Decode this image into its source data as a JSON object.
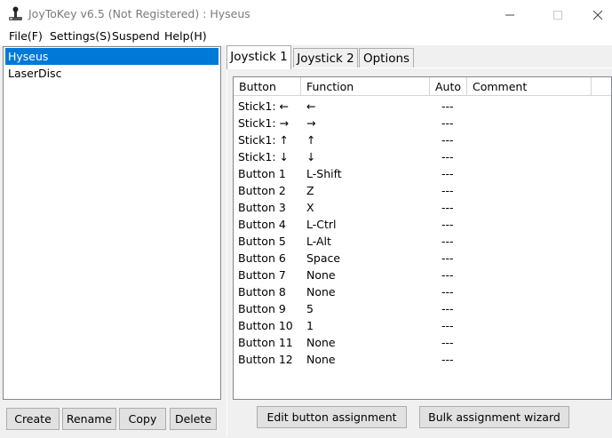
{
  "window": {
    "title": "JoyToKey v6.5 (Not Registered) : Hyseus",
    "icon": "joystick-app-icon"
  },
  "menu": {
    "items": [
      "File(F)",
      "Settings(S)",
      "Suspend",
      "Help(H)"
    ]
  },
  "profiles": {
    "items": [
      "Hyseus",
      "LaserDisc"
    ],
    "selected": "Hyseus"
  },
  "profile_buttons": {
    "create": "Create",
    "rename": "Rename",
    "copy": "Copy",
    "delete": "Delete"
  },
  "tabs": {
    "items": [
      "Joystick 1",
      "Joystick 2",
      "Options"
    ],
    "active": "Joystick 1"
  },
  "grid": {
    "headers": [
      "Button",
      "Function",
      "Auto",
      "Comment"
    ],
    "rows": [
      {
        "button": "Stick1: ←",
        "function": "←",
        "auto": "---",
        "comment": ""
      },
      {
        "button": "Stick1: →",
        "function": "→",
        "auto": "---",
        "comment": ""
      },
      {
        "button": "Stick1: ↑",
        "function": "↑",
        "auto": "---",
        "comment": ""
      },
      {
        "button": "Stick1: ↓",
        "function": "↓",
        "auto": "---",
        "comment": ""
      },
      {
        "button": "Button 1",
        "function": "L-Shift",
        "auto": "---",
        "comment": ""
      },
      {
        "button": "Button 2",
        "function": "Z",
        "auto": "---",
        "comment": ""
      },
      {
        "button": "Button 3",
        "function": "X",
        "auto": "---",
        "comment": ""
      },
      {
        "button": "Button 4",
        "function": "L-Ctrl",
        "auto": "---",
        "comment": ""
      },
      {
        "button": "Button 5",
        "function": "L-Alt",
        "auto": "---",
        "comment": ""
      },
      {
        "button": "Button 6",
        "function": "Space",
        "auto": "---",
        "comment": ""
      },
      {
        "button": "Button 7",
        "function": "None",
        "auto": "---",
        "comment": ""
      },
      {
        "button": "Button 8",
        "function": "None",
        "auto": "---",
        "comment": ""
      },
      {
        "button": "Button 9",
        "function": "5",
        "auto": "---",
        "comment": ""
      },
      {
        "button": "Button 10",
        "function": "1",
        "auto": "---",
        "comment": ""
      },
      {
        "button": "Button 11",
        "function": "None",
        "auto": "---",
        "comment": ""
      },
      {
        "button": "Button 12",
        "function": "None",
        "auto": "---",
        "comment": ""
      }
    ]
  },
  "bottom_buttons": {
    "edit": "Edit button assignment",
    "bulk": "Bulk assignment wizard"
  },
  "colors": {
    "selection": "#0078d7",
    "window_bg": "#f0f0f0",
    "title_text": "#7b7b7b"
  }
}
